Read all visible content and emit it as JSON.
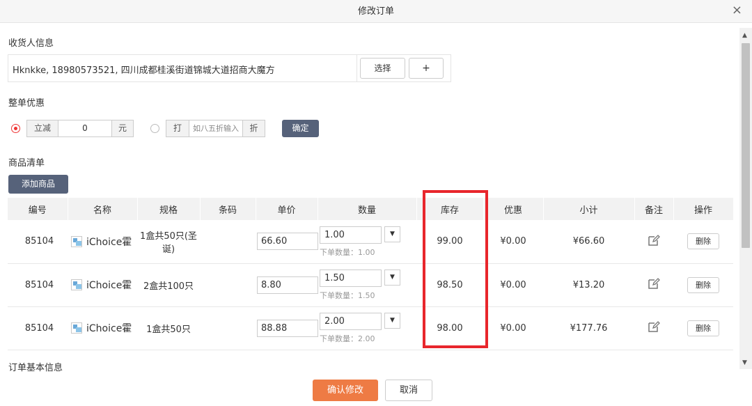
{
  "title": "修改订单",
  "close_symbol": "×",
  "receiver": {
    "label": "收货人信息",
    "address": "Hknkke, 18980573521, 四川成都桂溪街道锦城大道招商大魔方",
    "select_label": "选择",
    "add_label": "+"
  },
  "discount": {
    "label": "整单优惠",
    "option1": {
      "prefix": "立减",
      "value": "0",
      "suffix": "元",
      "selected": true
    },
    "option2": {
      "prefix": "打",
      "placeholder": "如八五折输入",
      "suffix": "折",
      "selected": false
    },
    "confirm_label": "确定"
  },
  "goods": {
    "label": "商品清单",
    "add_label": "添加商品",
    "columns": [
      "编号",
      "名称",
      "规格",
      "条码",
      "单价",
      "数量",
      "库存",
      "优惠",
      "小计",
      "备注",
      "操作"
    ],
    "rows": [
      {
        "id": "85104",
        "name": "iChoice霍",
        "spec": "1盒共50只(圣诞)",
        "barcode": "",
        "price": "66.60",
        "qty": "1.00",
        "qty_hint": "下单数量：1.00",
        "stock": "99.00",
        "discount": "¥0.00",
        "subtotal": "¥66.60",
        "delete_label": "删除"
      },
      {
        "id": "85104",
        "name": "iChoice霍",
        "spec": "2盒共100只",
        "barcode": "",
        "price": "8.80",
        "qty": "1.50",
        "qty_hint": "下单数量：1.50",
        "stock": "98.50",
        "discount": "¥0.00",
        "subtotal": "¥13.20",
        "delete_label": "删除"
      },
      {
        "id": "85104",
        "name": "iChoice霍",
        "spec": "1盒共50只",
        "barcode": "",
        "price": "88.88",
        "qty": "2.00",
        "qty_hint": "下单数量：2.00",
        "stock": "98.00",
        "discount": "¥0.00",
        "subtotal": "¥177.76",
        "delete_label": "删除"
      }
    ]
  },
  "order_info_label": "订单基本信息",
  "footer": {
    "confirm_label": "确认修改",
    "cancel_label": "取消"
  },
  "colors": {
    "accent_orange": "#e8771f",
    "confirm_button": "#ee7b44",
    "dark_button": "#56627a",
    "highlight": "#e8262c",
    "radio_selected": "#e33333"
  },
  "icons": {
    "close": "close-icon",
    "edit": "edit-icon",
    "dropdown": "chevron-down-icon",
    "thumbnail": "product-thumbnail-icon"
  }
}
